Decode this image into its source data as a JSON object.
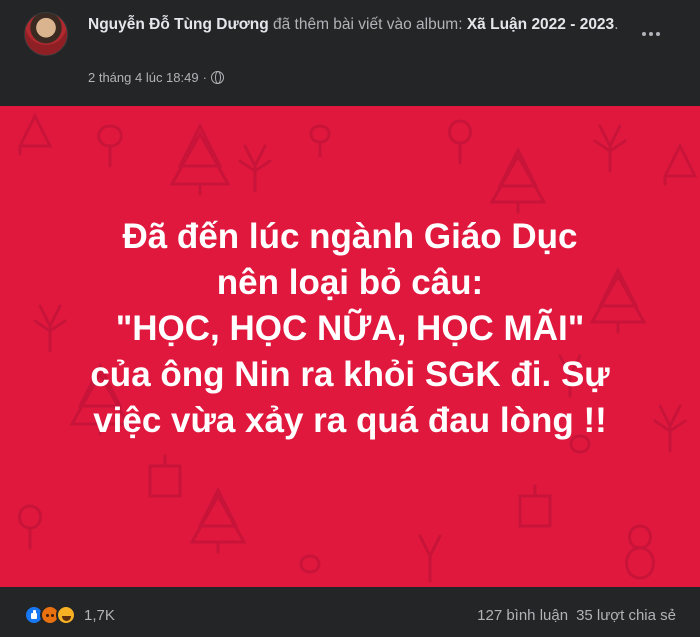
{
  "post": {
    "author": "Nguyễn Đỗ Tùng Dương",
    "action": " đã thêm bài viết vào album: ",
    "album": "Xã Luận 2022 - 2023",
    "album_suffix": ".",
    "timestamp": "2 tháng 4 lúc 18:49",
    "separator": "·",
    "privacy_icon": "globe-icon",
    "more_icon": "more-options-icon"
  },
  "image": {
    "background_color": "#e1183e",
    "text": "Đã đến lúc ngành Giáo Dục\nnên loại bỏ câu:\n\"HỌC, HỌC NỮA, HỌC MÃI\"\ncủa ông Nin ra khỏi SGK đi. Sự\nviệc vừa xảy ra quá đau lòng !!"
  },
  "footer": {
    "reaction_icons": [
      "like-icon",
      "angry-icon",
      "haha-icon"
    ],
    "reaction_count": "1,7K",
    "comments": "127 bình luận",
    "shares": "35 lượt chia sẻ"
  }
}
